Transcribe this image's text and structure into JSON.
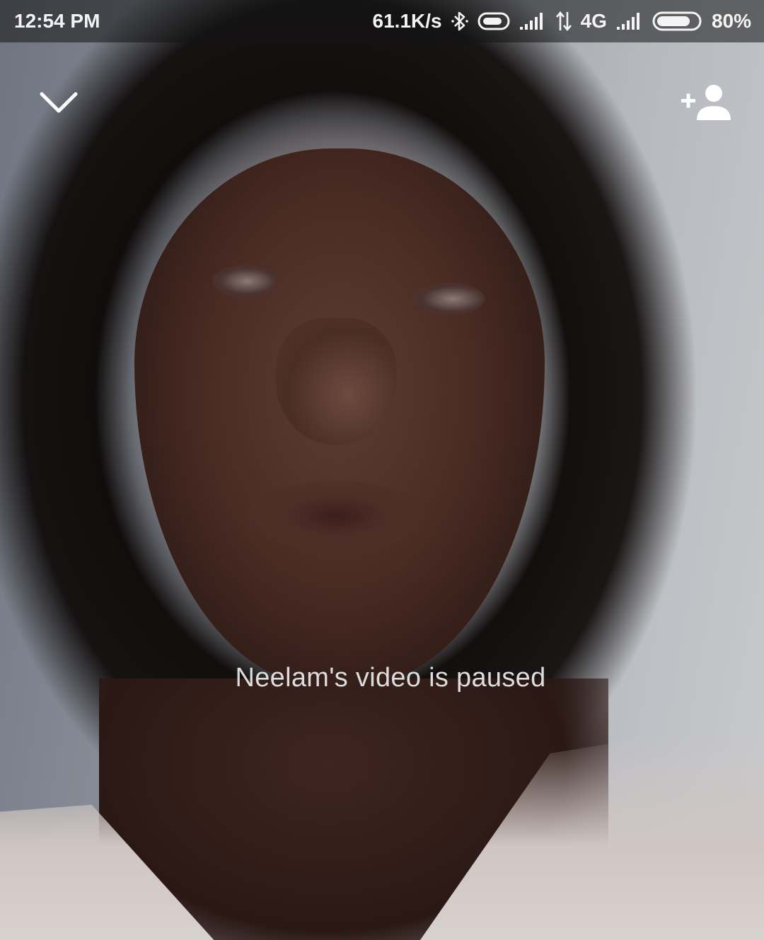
{
  "status_bar": {
    "time": "12:54 PM",
    "network_speed": "61.1K/s",
    "network_type": "4G",
    "battery_percent": "80%",
    "battery_level": 0.8,
    "icons": [
      "bluetooth-icon",
      "toggle-icon",
      "signal-icon",
      "data-transfer-icon",
      "signal-icon",
      "battery-icon"
    ]
  },
  "call": {
    "paused_message": "Neelam's video is paused",
    "icons": {
      "minimize": "chevron-down-icon",
      "add_person": "add-person-icon"
    }
  }
}
